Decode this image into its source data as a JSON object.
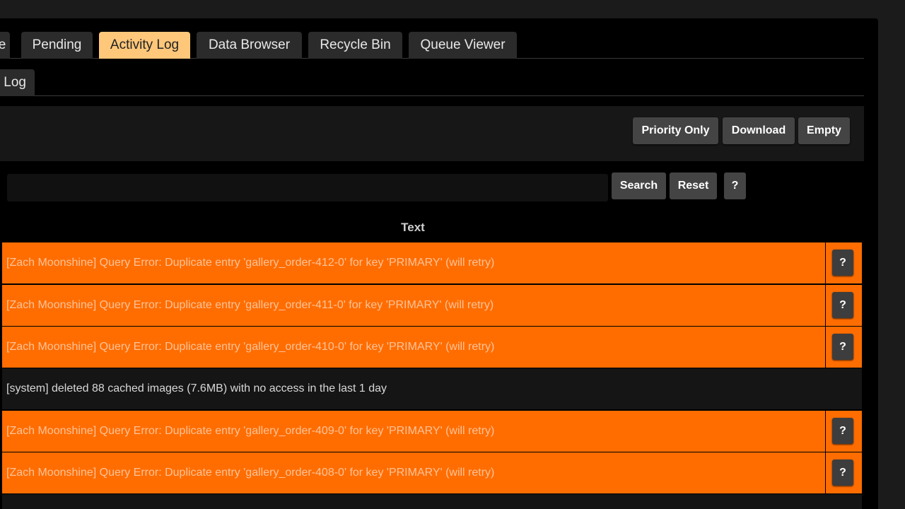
{
  "tabs_row1": [
    "e",
    "Pending",
    "Activity Log",
    "Data Browser",
    "Recycle Bin",
    "Queue Viewer"
  ],
  "active_tab": "Activity Log",
  "tabs_row2": [
    "Log"
  ],
  "toolbar": {
    "priority_only": "Priority Only",
    "download": "Download",
    "empty": "Empty"
  },
  "search": {
    "value": "",
    "search_label": "Search",
    "reset_label": "Reset",
    "help_label": "?"
  },
  "table": {
    "header": "Text",
    "rows": [
      {
        "type": "error",
        "text": "[Zach Moonshine] Query Error: Duplicate entry 'gallery_order-412-0' for key 'PRIMARY' (will retry)",
        "action": "?"
      },
      {
        "type": "error",
        "text": "[Zach Moonshine] Query Error: Duplicate entry 'gallery_order-411-0' for key 'PRIMARY' (will retry)",
        "action": "?"
      },
      {
        "type": "error",
        "text": "[Zach Moonshine] Query Error: Duplicate entry 'gallery_order-410-0' for key 'PRIMARY' (will retry)",
        "action": "?"
      },
      {
        "type": "system",
        "text": "[system] deleted 88 cached images (7.6MB) with no access in the last 1 day",
        "action": ""
      },
      {
        "type": "error",
        "text": "[Zach Moonshine] Query Error: Duplicate entry 'gallery_order-409-0' for key 'PRIMARY' (will retry)",
        "action": "?"
      },
      {
        "type": "error",
        "text": "[Zach Moonshine] Query Error: Duplicate entry 'gallery_order-408-0' for key 'PRIMARY' (will retry)",
        "action": "?"
      }
    ]
  },
  "colors": {
    "error_row": "#ff6d00",
    "error_text": "#ffc39a",
    "active_tab": "#fec77a",
    "background": "#000000"
  }
}
